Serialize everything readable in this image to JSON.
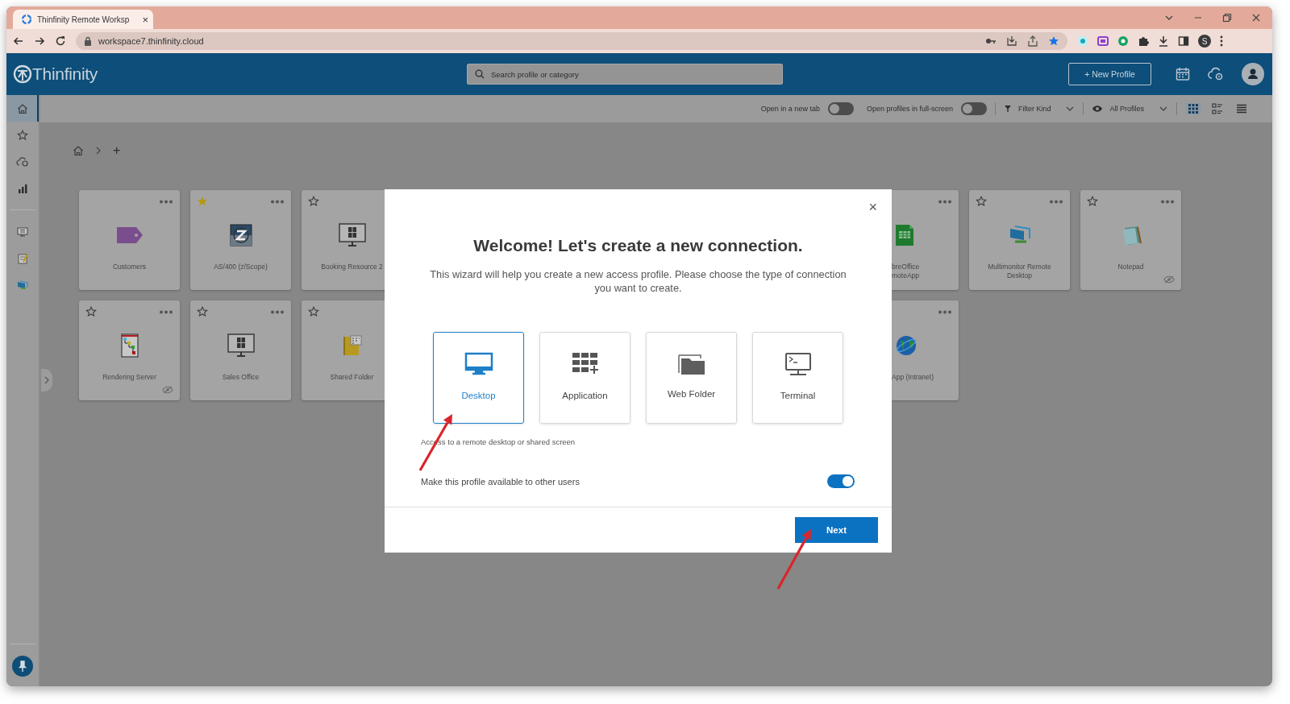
{
  "browser": {
    "tab": {
      "title": "Thinfinity Remote Worksp",
      "close": "×"
    },
    "url": "workspace7.thinfinity.cloud",
    "profile_initial": "S"
  },
  "header": {
    "logo": "Thinfinity",
    "search": {
      "placeholder": "Search profile or category"
    },
    "new_profile_button": "+ New Profile"
  },
  "toolbar": {
    "toggles": [
      {
        "label": "Open in a new tab",
        "on": false
      },
      {
        "label": "Open profiles in full-screen",
        "on": false
      }
    ],
    "filters": [
      {
        "kind": "filter",
        "label": "Filter Kind"
      },
      {
        "kind": "visibility",
        "label": "All Profiles"
      }
    ],
    "views": [
      {
        "kind": "grid",
        "selected": true
      },
      {
        "kind": "details",
        "selected": false
      },
      {
        "kind": "list",
        "selected": false
      }
    ]
  },
  "sidebar": {
    "items": [
      {
        "kind": "home",
        "selected": true
      },
      {
        "kind": "star",
        "selected": false
      },
      {
        "kind": "cloud",
        "selected": false
      },
      {
        "kind": "chart",
        "selected": false
      }
    ],
    "apps": [
      {
        "kind": "remote"
      },
      {
        "kind": "notepad"
      },
      {
        "kind": "multimonitor"
      }
    ]
  },
  "breadcrumb": {
    "current": "+"
  },
  "profile_rows": [
    {
      "left": [
        {
          "label": "Customers",
          "kind": "tag",
          "menu": true,
          "hidden": false
        },
        {
          "label": "AS/400 (z/Scope)",
          "kind": "zscope",
          "favorite": true,
          "menu": true,
          "hidden": false
        },
        {
          "label": "Booking Resource 2",
          "kind": "monitor",
          "favorite": false,
          "menu": false,
          "hidden": false
        }
      ],
      "right": [
        {
          "label": "breOffice moteApp",
          "kind": "calc",
          "menu": true,
          "hidden": false,
          "cut_off": true
        },
        {
          "label": "Multimonitor Remote Desktop",
          "kind": "multimonitor",
          "favorite": false,
          "menu": true,
          "hidden": false
        },
        {
          "label": "Notepad",
          "kind": "notepad",
          "favorite": false,
          "menu": true,
          "hidden": true
        }
      ]
    },
    {
      "left": [
        {
          "label": "Rendering Server",
          "kind": "tree",
          "favorite": false,
          "menu": true,
          "hidden": true
        },
        {
          "label": "Sales Office",
          "kind": "monitor",
          "favorite": false,
          "menu": true,
          "hidden": false
        },
        {
          "label": "Shared Folder",
          "kind": "folder",
          "favorite": false,
          "menu": false,
          "hidden": false
        }
      ],
      "right": [
        {
          "label": "App (Intranet)",
          "kind": "globe",
          "menu": true,
          "hidden": false,
          "cut_off": true
        }
      ]
    }
  ],
  "dialog": {
    "close": "×",
    "title": "Welcome! Let's create a new connection.",
    "intro": "This wizard will help you create a new access profile. Please choose the type of connection you want to create.",
    "types": [
      {
        "kind": "desktop",
        "label": "Desktop",
        "selected": true
      },
      {
        "kind": "application",
        "label": "Application",
        "selected": false
      },
      {
        "kind": "web-folder",
        "label": "Web Folder",
        "selected": false
      },
      {
        "kind": "terminal",
        "label": "Terminal",
        "selected": false
      }
    ],
    "description": "Access to a remote desktop or shared screen",
    "share_toggle": {
      "label": "Make this profile available to other users",
      "on": true
    },
    "next_button": "Next"
  }
}
